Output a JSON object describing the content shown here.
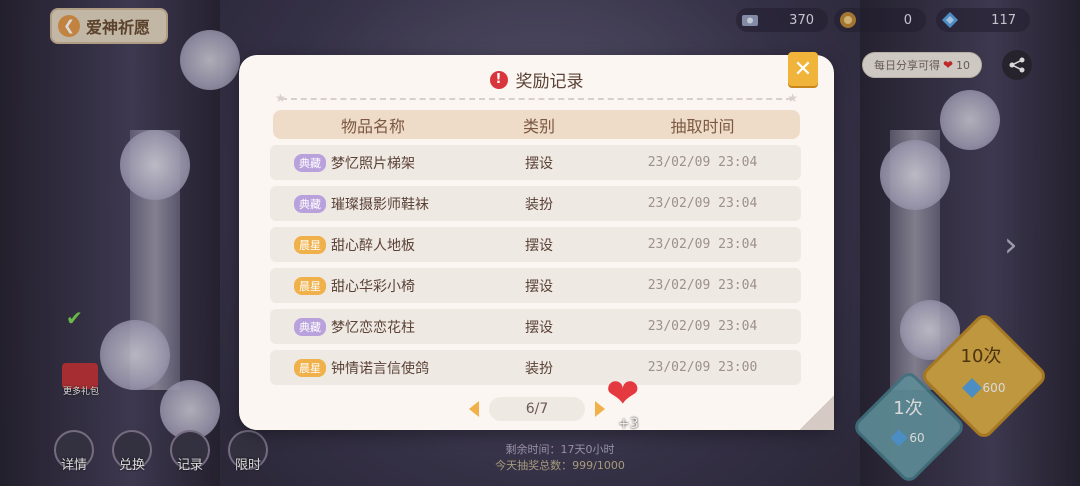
{
  "header": {
    "back_title": "爱神祈愿"
  },
  "currencies": [
    {
      "icon": "photo-ticket-icon",
      "value": "370"
    },
    {
      "icon": "mole-token-icon",
      "value": "0"
    },
    {
      "icon": "gem-star-icon",
      "value": "117"
    }
  ],
  "share": {
    "tip_prefix": "每日分享可得",
    "tip_amount": "10"
  },
  "dialog": {
    "title": "奖励记录",
    "columns": [
      "物品名称",
      "类别",
      "抽取时间"
    ],
    "rows": [
      {
        "tag": "典藏",
        "tag_color": "purple",
        "name": "梦忆照片梯架",
        "type": "摆设",
        "time": "23/02/09 23:04"
      },
      {
        "tag": "典藏",
        "tag_color": "purple",
        "name": "璀璨摄影师鞋袜",
        "type": "装扮",
        "time": "23/02/09 23:04"
      },
      {
        "tag": "晨星",
        "tag_color": "orange",
        "name": "甜心醉人地板",
        "type": "摆设",
        "time": "23/02/09 23:04"
      },
      {
        "tag": "晨星",
        "tag_color": "orange",
        "name": "甜心华彩小椅",
        "type": "摆设",
        "time": "23/02/09 23:04"
      },
      {
        "tag": "典藏",
        "tag_color": "purple",
        "name": "梦忆恋恋花柱",
        "type": "摆设",
        "time": "23/02/09 23:04"
      },
      {
        "tag": "晨星",
        "tag_color": "orange",
        "name": "钟情诺言信使鸽",
        "type": "装扮",
        "time": "23/02/09 23:00"
      }
    ],
    "pager": {
      "current": "6/7"
    }
  },
  "heart_bonus": "+3",
  "draw": {
    "ten_label": "10次",
    "ten_cost": "600",
    "one_label": "1次",
    "one_cost": "60"
  },
  "bottom_buttons": [
    "详情",
    "兑换",
    "记录",
    "限时"
  ],
  "more_gift": "更多礼包",
  "remain_time": "剩余时间：17天0小时",
  "today_progress": "今天抽奖总数：999/1000"
}
